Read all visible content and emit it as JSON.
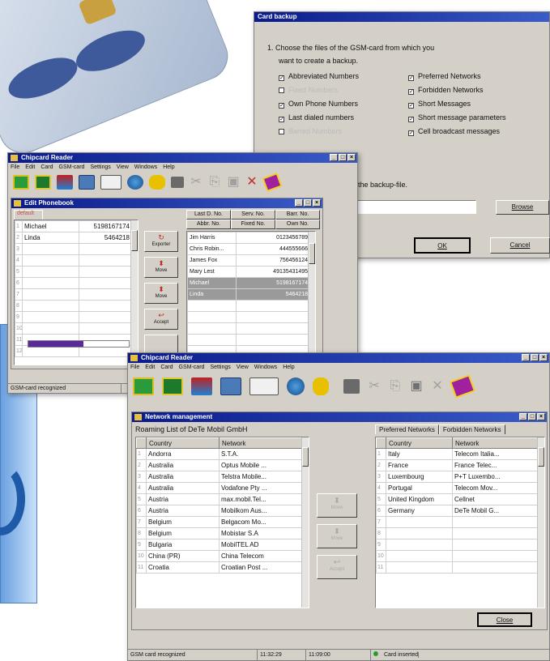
{
  "backup": {
    "title": "Card backup",
    "instruction_1": "1. Choose the files of the GSM-card from which you",
    "instruction_2": "want to create a backup.",
    "options": [
      {
        "label": "Abbreviated Numbers",
        "checked": true,
        "enabled": true
      },
      {
        "label": "Preferred Networks",
        "checked": true,
        "enabled": true
      },
      {
        "label": "Fixed Numbers",
        "checked": false,
        "enabled": false
      },
      {
        "label": "Forbidden Networks",
        "checked": true,
        "enabled": true
      },
      {
        "label": "Own Phone Numbers",
        "checked": true,
        "enabled": true
      },
      {
        "label": "Short Messages",
        "checked": true,
        "enabled": true
      },
      {
        "label": "Last dialed numbers",
        "checked": true,
        "enabled": true
      },
      {
        "label": "Short message parameters",
        "checked": true,
        "enabled": true
      },
      {
        "label": "Barred Numbers",
        "checked": false,
        "enabled": false
      },
      {
        "label": "Cell broadcast messages",
        "checked": true,
        "enabled": true
      }
    ],
    "step2": "the backup-file.",
    "browse": "Browse",
    "ok": "OK",
    "cancel": "Cancel"
  },
  "reader_back": {
    "title": "Chipcard Reader",
    "menu": [
      "File",
      "Edit",
      "Card",
      "GSM-card",
      "Settings",
      "View",
      "Windows",
      "Help"
    ],
    "status": "GSM-card recognized"
  },
  "phonebook": {
    "title": "Edit Phonebook",
    "tab": "default",
    "entries": [
      {
        "name": "Michael",
        "number": "5198167174"
      },
      {
        "name": "Linda",
        "number": "5464218"
      }
    ],
    "buttons": [
      "Exporter",
      "Move",
      "Move",
      "Accept"
    ],
    "right_tabs_row1": [
      "Last D. No.",
      "Serv. No.",
      "Barr. No."
    ],
    "right_tabs_row2": [
      "Abbr. No.",
      "Fixed No.",
      "Own No."
    ],
    "list": [
      {
        "name": "Jim Harris",
        "number": "0123456789",
        "selected": false
      },
      {
        "name": "Chris Robin...",
        "number": "444555666",
        "selected": false
      },
      {
        "name": "James Fox",
        "number": "756456124",
        "selected": false
      },
      {
        "name": "Mary Lest",
        "number": "49135431495",
        "selected": false
      },
      {
        "name": "Michael",
        "number": "5198167174",
        "selected": true
      },
      {
        "name": "Linda",
        "number": "5464218",
        "selected": true
      }
    ],
    "row_numbers": [
      "1",
      "2",
      "3",
      "4",
      "5",
      "6",
      "7",
      "8",
      "9",
      "10",
      "11",
      "12"
    ]
  },
  "reader_front": {
    "title": "Chipcard Reader",
    "menu": [
      "File",
      "Edit",
      "Card",
      "GSM-card",
      "Settings",
      "View",
      "Windows",
      "Help"
    ],
    "status_text": "GSM card recognized",
    "time1": "11:32:29",
    "time2": "11:09:00",
    "card_status": "Card inserted"
  },
  "network": {
    "title": "Network management",
    "roaming_label": "Roaming List of DeTe Mobil GmbH",
    "col_country": "Country",
    "col_network": "Network",
    "roaming": [
      [
        "Andorra",
        "S.T.A."
      ],
      [
        "Australia",
        "Optus Mobile ..."
      ],
      [
        "Australia",
        "Telstra Mobile..."
      ],
      [
        "Australia",
        "Vodafone Pty ..."
      ],
      [
        "Austria",
        "max.mobil.Tel..."
      ],
      [
        "Austria",
        "Mobilkom Aus..."
      ],
      [
        "Belgium",
        "Belgacom Mo..."
      ],
      [
        "Belgium",
        "Mobistar S.A"
      ],
      [
        "Bulgaria",
        "MobilTEL AD"
      ],
      [
        "China (PR)",
        "China Telecom"
      ],
      [
        "Croatia",
        "Croatian Post ..."
      ]
    ],
    "mid_buttons": [
      "Move",
      "Move",
      "Accept"
    ],
    "tab_preferred": "Preferred Networks",
    "tab_forbidden": "Forbidden Networks",
    "preferred": [
      [
        "Italy",
        "Telecom Italia..."
      ],
      [
        "France",
        "France Telec..."
      ],
      [
        "Luxembourg",
        "P+T Luxembo..."
      ],
      [
        "Portugal",
        "Telecom Mov..."
      ],
      [
        "United Kingdom",
        "Cellnet"
      ],
      [
        "Germany",
        "DeTe Mobil G..."
      ]
    ],
    "close": "Close"
  },
  "colors": {
    "titlebar": "#0a1a8a",
    "chrome": "#d4d0c8",
    "card_status_dot": "#20a020",
    "card_blue": "#1e5aa8"
  }
}
